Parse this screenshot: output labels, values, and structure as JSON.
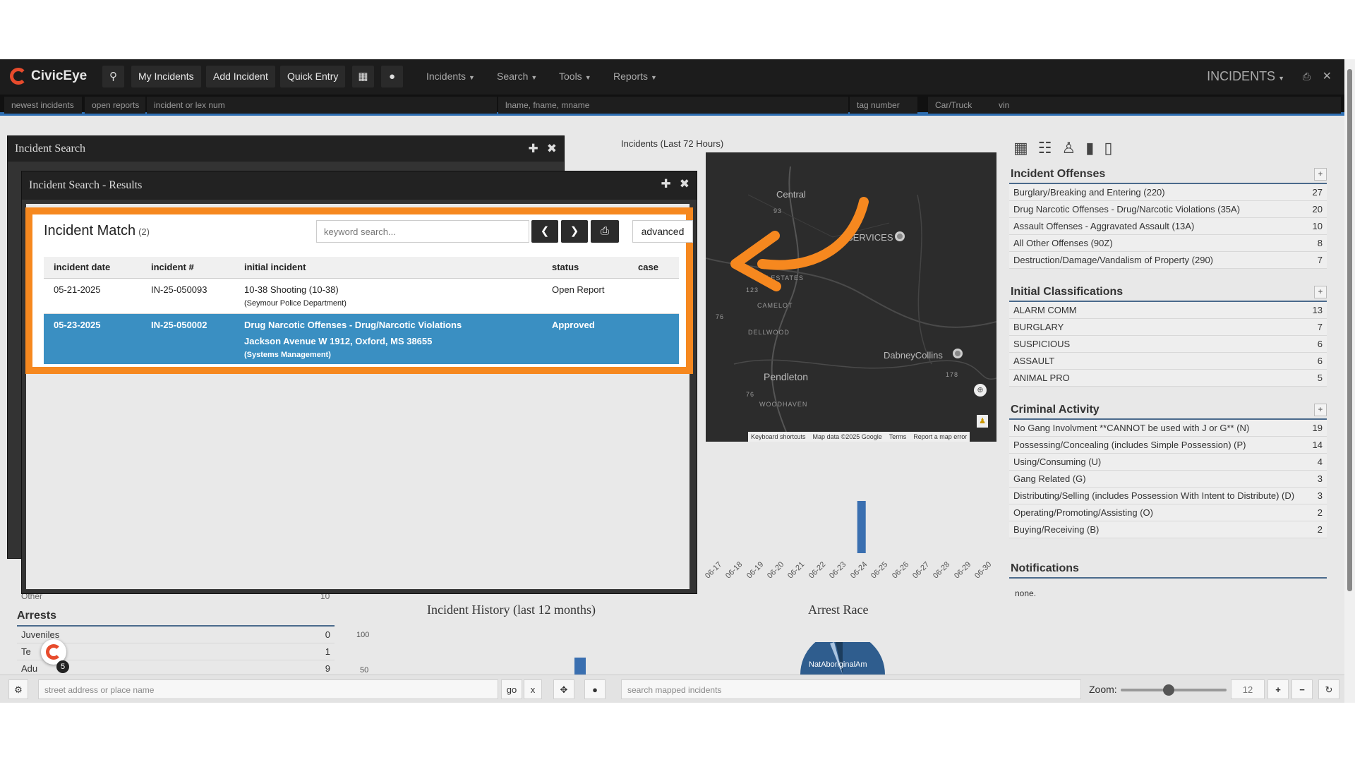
{
  "nav": {
    "brand": "CivicEye",
    "buttons": [
      "My Incidents",
      "Add Incident",
      "Quick Entry"
    ],
    "menus": [
      "Incidents",
      "Search",
      "Tools",
      "Reports"
    ],
    "module_title": "INCIDENTS"
  },
  "searchbar": {
    "newest": "newest incidents",
    "open_reports": "open reports",
    "incident_num_placeholder": "incident or lex num",
    "name_placeholder": "lname, fname, mname",
    "tag_placeholder": "tag number",
    "vehicle_placeholder": "Car/Truck",
    "vin_placeholder": "vin"
  },
  "map": {
    "title": "Incidents (Last 72 Hours)",
    "labels": [
      "Central",
      "SERVICES",
      "EY ESTATES",
      "CAMELOT",
      "DELLWOOD",
      "DabneyCollins",
      "Pendleton",
      "WOODHAVEN"
    ],
    "footer": [
      "Keyboard shortcuts",
      "Map data ©2025 Google",
      "Terms",
      "Report a map error"
    ],
    "shields": [
      "93",
      "123",
      "76",
      "178",
      "76"
    ]
  },
  "chart_data": {
    "type": "bar",
    "categories": [
      "06-17",
      "06-18",
      "06-19",
      "06-20",
      "06-21",
      "06-22",
      "06-23",
      "06-24",
      "06-25",
      "06-26",
      "06-27",
      "06-28",
      "06-29",
      "06-30"
    ],
    "values": [
      0,
      0,
      0,
      0,
      0,
      0,
      0,
      1,
      0,
      0,
      0,
      0,
      0,
      0
    ]
  },
  "panels": {
    "offenses": {
      "title": "Incident Offenses",
      "items": [
        {
          "label": "Burglary/Breaking and Entering (220)",
          "count": "27"
        },
        {
          "label": "Drug Narcotic Offenses - Drug/Narcotic Violations (35A)",
          "count": "20"
        },
        {
          "label": "Assault Offenses - Aggravated Assault (13A)",
          "count": "10"
        },
        {
          "label": "All Other Offenses (90Z)",
          "count": "8"
        },
        {
          "label": "Destruction/Damage/Vandalism of Property (290)",
          "count": "7"
        }
      ]
    },
    "classifications": {
      "title": "Initial Classifications",
      "items": [
        {
          "label": "ALARM COMM",
          "count": "13"
        },
        {
          "label": "BURGLARY",
          "count": "7"
        },
        {
          "label": "SUSPICIOUS",
          "count": "6"
        },
        {
          "label": "ASSAULT",
          "count": "6"
        },
        {
          "label": "ANIMAL PRO",
          "count": "5"
        }
      ]
    },
    "criminal": {
      "title": "Criminal Activity",
      "items": [
        {
          "label": "No Gang Involvment **CANNOT be used with J or G** (N)",
          "count": "19"
        },
        {
          "label": "Possessing/Concealing (includes Simple Possession) (P)",
          "count": "14"
        },
        {
          "label": "Using/Consuming (U)",
          "count": "4"
        },
        {
          "label": "Gang Related (G)",
          "count": "3"
        },
        {
          "label": "Distributing/Selling (includes Possession With Intent to Distribute) (D)",
          "count": "3"
        },
        {
          "label": "Operating/Promoting/Assisting (O)",
          "count": "2"
        },
        {
          "label": "Buying/Receiving (B)",
          "count": "2"
        }
      ]
    },
    "notifications": {
      "title": "Notifications",
      "empty": "none."
    }
  },
  "arrests": {
    "title": "Arrests",
    "rows": [
      {
        "label": "Juveniles",
        "count": "0"
      },
      {
        "label": "Te",
        "count": "1"
      },
      {
        "label": "Adu",
        "count": "9"
      }
    ],
    "other_label": "Other",
    "other_count": "10"
  },
  "history": {
    "title": "Incident History (last 12 months)",
    "ticks": [
      "100",
      "50"
    ]
  },
  "race": {
    "title": "Arrest Race",
    "label": "NatAboriginalAm"
  },
  "windows": {
    "search_title": "Incident Search",
    "results_title": "Incident Search - Results"
  },
  "results": {
    "title": "Incident Match",
    "count": "(2)",
    "keyword_placeholder": "keyword search...",
    "advanced": "advanced",
    "columns": [
      "incident date",
      "incident #",
      "initial incident",
      "status",
      "case"
    ],
    "rows": [
      {
        "date": "05-21-2025",
        "number": "IN-25-050093",
        "incident": "10-38 Shooting (10-38)",
        "address": "",
        "agency": "(Seymour Police Department)",
        "status": "Open Report",
        "case": ""
      },
      {
        "date": "05-23-2025",
        "number": "IN-25-050002",
        "incident": "Drug Narcotic Offenses - Drug/Narcotic Violations",
        "address": "Jackson Avenue W 1912, Oxford, MS 38655",
        "agency": "(Systems Management)",
        "status": "Approved",
        "case": ""
      }
    ]
  },
  "bottombar": {
    "address_placeholder": "street address or place name",
    "go": "go",
    "clear": "x",
    "mapped_placeholder": "search mapped incidents",
    "zoom_label": "Zoom:",
    "zoom_value": "12",
    "zoom_fraction": 0.45
  },
  "badge_count": "5",
  "colors": {
    "accent": "#f6881f",
    "selected_row": "#3a8fc2",
    "brand": "#e74b2c"
  }
}
